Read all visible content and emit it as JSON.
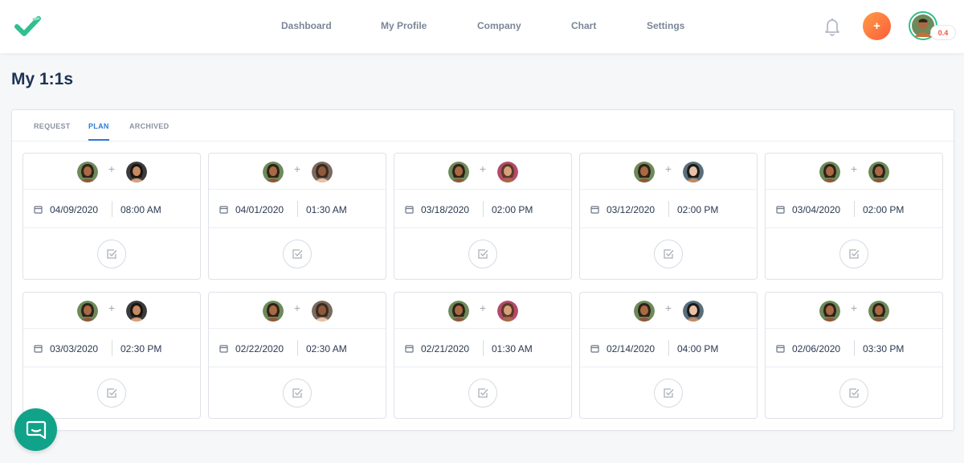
{
  "header": {
    "nav": [
      "Dashboard",
      "My Profile",
      "Company",
      "Chart",
      "Settings"
    ],
    "add_label": "+",
    "score_badge": "0.4"
  },
  "page": {
    "title": "My 1:1s"
  },
  "tabs": [
    {
      "label": "REQUEST",
      "active": false
    },
    {
      "label": "PLAN",
      "active": true
    },
    {
      "label": "ARCHIVED",
      "active": false
    }
  ],
  "meetings": [
    {
      "date": "04/09/2020",
      "time": "08:00 AM"
    },
    {
      "date": "04/01/2020",
      "time": "01:30 AM"
    },
    {
      "date": "03/18/2020",
      "time": "02:00 PM"
    },
    {
      "date": "03/12/2020",
      "time": "02:00 PM"
    },
    {
      "date": "03/04/2020",
      "time": "02:00 PM"
    },
    {
      "date": "03/03/2020",
      "time": "02:30 PM"
    },
    {
      "date": "02/22/2020",
      "time": "02:30 AM"
    },
    {
      "date": "02/21/2020",
      "time": "01:30 AM"
    },
    {
      "date": "02/14/2020",
      "time": "04:00 PM"
    },
    {
      "date": "02/06/2020",
      "time": "03:30 PM"
    }
  ],
  "colors": {
    "brand_green": "#2fc08e",
    "accent_blue": "#2b7bd6",
    "add_gradient_start": "#ff9c45",
    "add_gradient_end": "#fb5c3b",
    "chat_teal": "#10a38a"
  }
}
